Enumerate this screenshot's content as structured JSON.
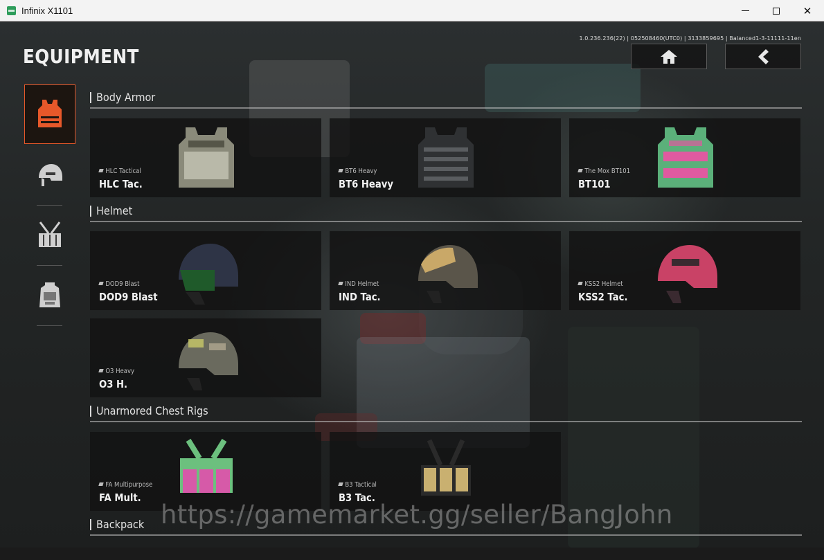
{
  "window": {
    "title": "Infinix X1101",
    "minimize": "–",
    "close": "✕"
  },
  "header": {
    "title": "EQUIPMENT",
    "version": "1.0.236.236(22) | 052508460(UTC0) | 3133859695 | Balanced1-3-11111-11en",
    "home_icon": "home-icon",
    "back_icon": "chevron-left-icon"
  },
  "sidebar": {
    "items": [
      {
        "name": "body-armor",
        "icon": "vest-icon",
        "active": true,
        "color": "#e6582a"
      },
      {
        "name": "helmet",
        "icon": "helmet-icon",
        "active": false
      },
      {
        "name": "chest-rig",
        "icon": "chest-rig-icon",
        "active": false
      },
      {
        "name": "backpack",
        "icon": "backpack-icon",
        "active": false
      }
    ]
  },
  "sections": [
    {
      "title": "Body Armor",
      "items": [
        {
          "sub": "HLC Tactical",
          "name": "HLC Tac.",
          "color": "#8a8a7a",
          "accent": "#d8d8c8",
          "kind": "vest"
        },
        {
          "sub": "BT6 Heavy",
          "name": "BT6 Heavy",
          "color": "#2f3133",
          "accent": "#5a5d60",
          "kind": "vest"
        },
        {
          "sub": "The Mox BT101",
          "name": "BT101",
          "color": "#5bb07a",
          "accent": "#e05aa0",
          "kind": "vest"
        }
      ]
    },
    {
      "title": "Helmet",
      "items": [
        {
          "sub": "DOD9 Blast",
          "name": "DOD9 Blast",
          "color": "#2e3446",
          "accent": "#1f5a2a",
          "kind": "helmet"
        },
        {
          "sub": "IND Helmet",
          "name": "IND Tac.",
          "color": "#5a554a",
          "accent": "#c9a868",
          "kind": "helmet"
        },
        {
          "sub": "KSS2 Helmet",
          "name": "KSS2 Tac.",
          "color": "#c94266",
          "accent": "#3a2a30",
          "kind": "helmet"
        },
        {
          "sub": "O3 Heavy",
          "name": "O3 H.",
          "color": "#6a6a5e",
          "accent": "#c9c968",
          "kind": "helmet"
        }
      ]
    },
    {
      "title": "Unarmored Chest Rigs",
      "items": [
        {
          "sub": "FA Multipurpose",
          "name": "FA Mult.",
          "color": "#6cc07e",
          "accent": "#d65aa8",
          "kind": "rig"
        },
        {
          "sub": "B3 Tactical",
          "name": "B3 Tac.",
          "color": "#2a2a2a",
          "accent": "#c9b070",
          "kind": "rig"
        }
      ]
    },
    {
      "title": "Backpack",
      "items": []
    }
  ],
  "watermark": "https://gamemarket.gg/seller/BangJohn"
}
